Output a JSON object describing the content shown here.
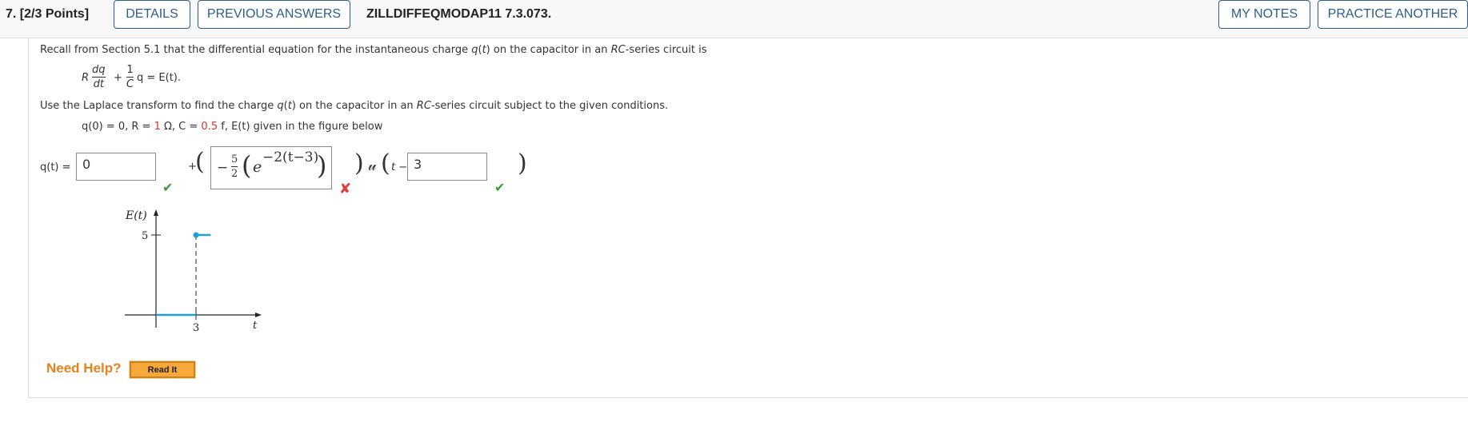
{
  "header": {
    "question_number": "7.",
    "points": "[2/3 Points]",
    "details_label": "DETAILS",
    "previous_answers_label": "PREVIOUS ANSWERS",
    "problem_code": "ZILLDIFFEQMODAP11 7.3.073.",
    "my_notes_label": "MY NOTES",
    "practice_another_label": "PRACTICE ANOTHER"
  },
  "problem": {
    "intro_a": "Recall from Section 5.1 that the differential equation for the instantaneous charge ",
    "intro_q": "q",
    "intro_b": "(",
    "intro_t": "t",
    "intro_c": ") on the capacitor in an ",
    "intro_rc": "RC",
    "intro_d": "-series circuit is",
    "eq_R": "R",
    "eq_dq": "dq",
    "eq_dt": "dt",
    "eq_plus": "+",
    "eq_one": "1",
    "eq_C": "C",
    "eq_rest": "q = E(t).",
    "use_a": "Use the Laplace transform to find the charge ",
    "use_q": "q",
    "use_b": "(",
    "use_t": "t",
    "use_c": ") on the capacitor in an ",
    "use_rc": "RC",
    "use_d": "-series circuit subject to the given conditions.",
    "cond_a": "q(0) = 0, R = ",
    "cond_R": "1",
    "cond_b": " Ω, C = ",
    "cond_C": "0.5",
    "cond_c": " f, E(t) given in the figure below"
  },
  "answer": {
    "lhs": "q(t) =",
    "box1_value": "0",
    "plus": "+",
    "box2_minus": "−",
    "box2_num": "5",
    "box2_den": "2",
    "box2_e": "e",
    "box2_exp": "−2(t−3)",
    "u_symbol": "𝓊",
    "u_t": "t −",
    "box3_value": "3"
  },
  "graph": {
    "ylabel": "E(t)",
    "y_tick": "5",
    "x_tick": "3",
    "xlabel": "t"
  },
  "chart_data": {
    "type": "line",
    "title": "",
    "xlabel": "t",
    "ylabel": "E(t)",
    "x_ticks": [
      3
    ],
    "y_ticks": [
      5
    ],
    "series": [
      {
        "x": [
          0,
          3
        ],
        "y": [
          0,
          0
        ]
      },
      {
        "x": [
          3,
          4.1
        ],
        "y": [
          5,
          5
        ]
      }
    ],
    "closed_point": {
      "x": 3,
      "y": 5
    },
    "dashed_line": {
      "x": 3,
      "y_from": 0,
      "y_to": 5
    },
    "line_color": "#1ba0d8"
  },
  "help": {
    "need_help": "Need Help?",
    "read_it": "Read It"
  },
  "colors": {
    "accent": "#2c5d8f",
    "correct": "#3d9a36",
    "incorrect": "#e03a3a",
    "help": "#e8821a",
    "highlight_number": "#d8352a"
  }
}
